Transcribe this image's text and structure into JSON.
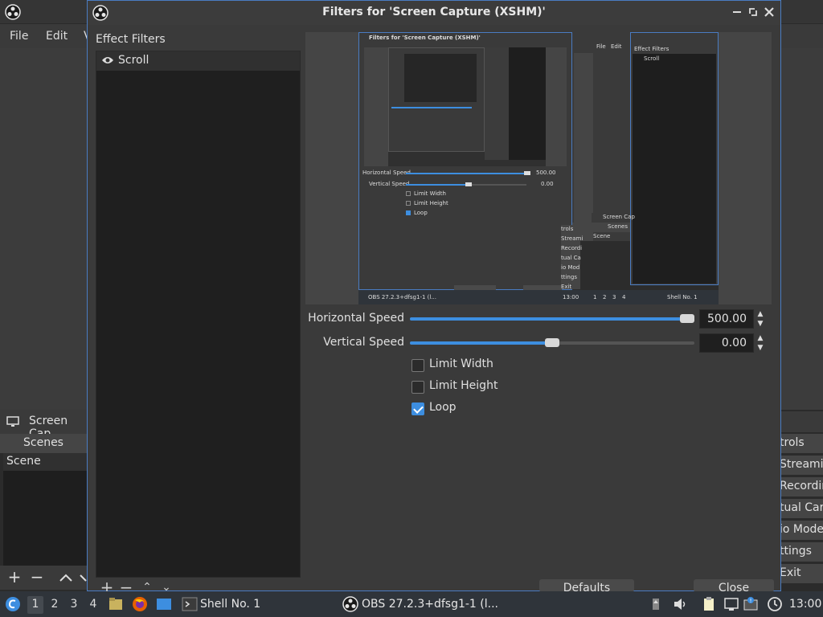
{
  "main_window": {
    "menu": [
      "File",
      "Edit",
      "V"
    ],
    "source_label": "Screen Cap",
    "scenes_header": "Scenes",
    "scenes": [
      "Scene"
    ],
    "controls_header": "trols",
    "controls": [
      "Streamin",
      "Recordin",
      "tual Car",
      "io Mode",
      "ttings",
      "Exit"
    ]
  },
  "dialog": {
    "title": "Filters for 'Screen Capture (XSHM)'",
    "effect_filters_label": "Effect Filters",
    "filters": [
      {
        "name": "Scroll",
        "visible": true
      }
    ],
    "properties": {
      "horizontal_speed_label": "Horizontal Speed",
      "horizontal_speed_value": "500.00",
      "horizontal_speed_fraction": 1.0,
      "vertical_speed_label": "Vertical Speed",
      "vertical_speed_value": "0.00",
      "vertical_speed_fraction": 0.5,
      "limit_width_label": "Limit Width",
      "limit_width_checked": false,
      "limit_height_label": "Limit Height",
      "limit_height_checked": false,
      "loop_label": "Loop",
      "loop_checked": true
    },
    "defaults_button": "Defaults",
    "close_button": "Close"
  },
  "preview_mini": {
    "title": "Filters for 'Screen Capture (XSHM)'",
    "file": "File",
    "edit": "Edit",
    "effect_filters": "Effect Filters",
    "scroll": "Scroll",
    "h_speed": "Horizontal Speed",
    "h_value": "500.00",
    "v_speed": "Vertical Speed",
    "v_value": "0.00",
    "limit_width": "Limit Width",
    "limit_height": "Limit Height",
    "loop": "Loop",
    "screen_cap": "Screen Cap",
    "scenes": "Scenes",
    "scene": "Scene",
    "controls": [
      "trols",
      "Streami",
      "Recordi",
      "tual Ca",
      "io Mod",
      "ttings",
      "Exit"
    ],
    "defaults": "Defaults",
    "close": "Close",
    "taskbar_app": "OBS 27.2.3+dfsg1-1 (l...",
    "taskbar_time": "13:00",
    "taskbar_shell": "Shell No. 1",
    "workspaces": [
      "1",
      "2",
      "3",
      "4"
    ]
  },
  "taskbar": {
    "workspaces": [
      "1",
      "2",
      "3",
      "4"
    ],
    "active_workspace": "1",
    "shell_label": "Shell No. 1",
    "obs_label": "OBS 27.2.3+dfsg1-1 (l...",
    "time": "13:00"
  },
  "colors": {
    "accent": "#3d8ee0",
    "dialog_border": "#4a7cc2"
  }
}
